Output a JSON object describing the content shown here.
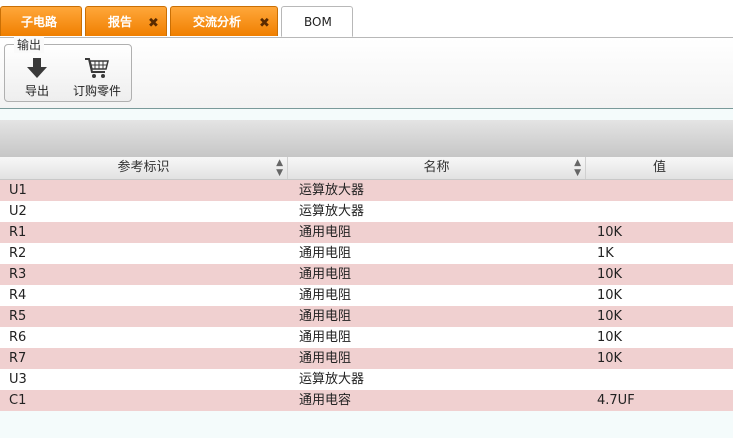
{
  "tabs": [
    {
      "label": "子电路",
      "closable": false,
      "active": false
    },
    {
      "label": "报告",
      "closable": true,
      "active": false
    },
    {
      "label": "交流分析",
      "closable": true,
      "active": false
    },
    {
      "label": "BOM",
      "closable": false,
      "active": true
    }
  ],
  "toolbar": {
    "group_title": "输出",
    "export_label": "导出",
    "order_label": "订购零件"
  },
  "table": {
    "columns": [
      "参考标识",
      "名称",
      "值"
    ],
    "rows": [
      {
        "ref": "U1",
        "name": "运算放大器",
        "value": ""
      },
      {
        "ref": "U2",
        "name": "运算放大器",
        "value": ""
      },
      {
        "ref": "R1",
        "name": "通用电阻",
        "value": "10K"
      },
      {
        "ref": "R2",
        "name": "通用电阻",
        "value": "1K"
      },
      {
        "ref": "R3",
        "name": "通用电阻",
        "value": "10K"
      },
      {
        "ref": "R4",
        "name": "通用电阻",
        "value": "10K"
      },
      {
        "ref": "R5",
        "name": "通用电阻",
        "value": "10K"
      },
      {
        "ref": "R6",
        "name": "通用电阻",
        "value": "10K"
      },
      {
        "ref": "R7",
        "name": "通用电阻",
        "value": "10K"
      },
      {
        "ref": "U3",
        "name": "运算放大器",
        "value": ""
      },
      {
        "ref": "C1",
        "name": "通用电容",
        "value": "4.7UF"
      }
    ]
  },
  "icons": {
    "close": "close-icon",
    "export": "download-arrow-icon",
    "order": "shopping-cart-icon",
    "sort": "sort-updown-icon"
  },
  "colors": {
    "tab_orange": "#f28a0f",
    "row_pink": "#f0d0d0",
    "row_white": "#ffffff"
  }
}
